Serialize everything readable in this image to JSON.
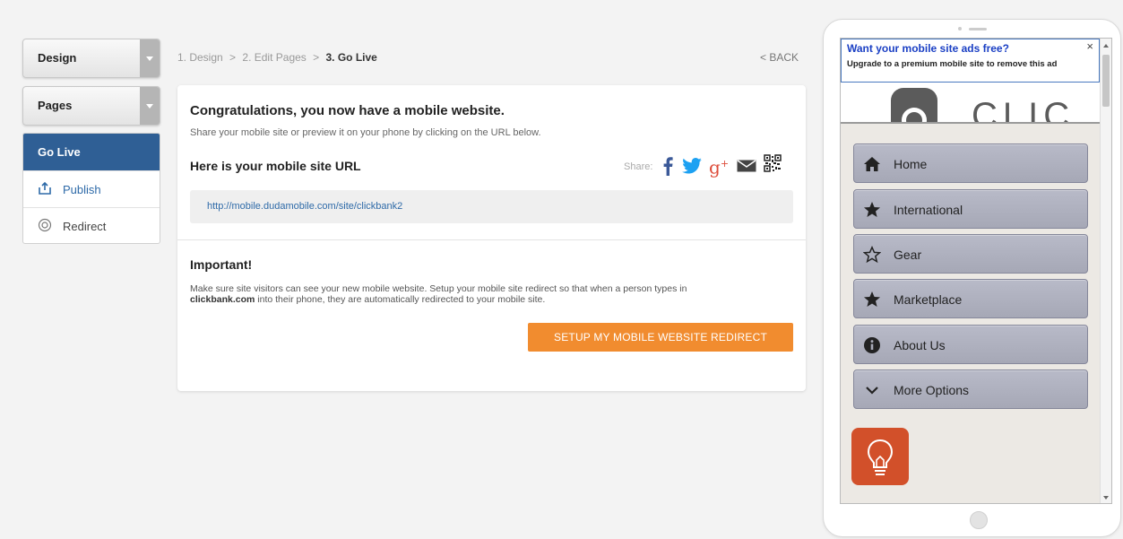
{
  "sidebar": {
    "design_label": "Design",
    "pages_label": "Pages",
    "golive_label": "Go Live",
    "publish_label": "Publish",
    "redirect_label": "Redirect"
  },
  "breadcrumb": {
    "step1": "1. Design",
    "sep": ">",
    "step2": "2. Edit Pages",
    "step3": "3. Go Live",
    "back": "< BACK"
  },
  "main": {
    "congrats": "Congratulations, you now have a mobile website.",
    "subtitle": "Share your mobile site or preview it on your phone by clicking on the URL below.",
    "url_title": "Here is your mobile site URL",
    "share_label": "Share:",
    "url": "http://mobile.dudamobile.com/site/clickbank2",
    "important_title": "Important!",
    "important_text_1": "Make sure site visitors can see your new mobile website. Setup your mobile site redirect so that when a person types in",
    "important_bold": "clickbank.com",
    "important_text_2": "into their phone, they are automatically redirected to your mobile site.",
    "setup_button": "SETUP MY MOBILE WEBSITE REDIRECT"
  },
  "phone": {
    "ad_title": "Want your mobile site ads free?",
    "ad_text": "Upgrade to a premium mobile site to remove this ad",
    "ad_close": "×",
    "logo_text": "CLIC",
    "nav": [
      {
        "label": "Home",
        "icon": "home-icon"
      },
      {
        "label": "International",
        "icon": "star-filled-icon"
      },
      {
        "label": "Gear",
        "icon": "star-outline-icon"
      },
      {
        "label": "Marketplace",
        "icon": "star-filled-icon"
      },
      {
        "label": "About Us",
        "icon": "info-icon"
      },
      {
        "label": "More Options",
        "icon": "chevron-down-icon"
      }
    ]
  },
  "colors": {
    "accent_blue": "#2f5f95",
    "orange": "#f18c2f",
    "nav_gray": "#a6a8b6",
    "bulb_red": "#d2502a"
  }
}
